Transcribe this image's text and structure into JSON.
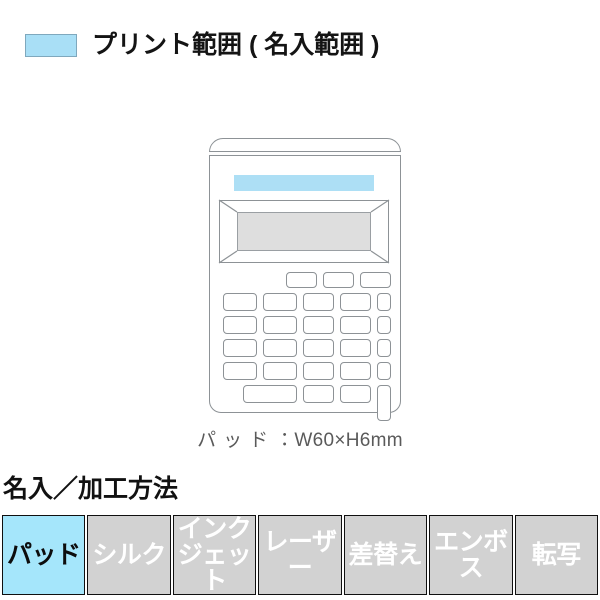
{
  "legend": {
    "swatch_color": "#a9dff6",
    "swatch_border_color": "#7fa8bd",
    "label": "プリント範囲 ( 名入範囲 )"
  },
  "product": {
    "name": "calculator-illustration",
    "imprint_band_color": "#addff5",
    "display_color": "#dedede",
    "outline_color": "#8d9296",
    "dimension_caption": {
      "method": "パッド",
      "separator": "：",
      "size": "W60×H6mm",
      "full": "パッド：W60×H6mm"
    }
  },
  "method_section": {
    "heading": "名入／加工方法",
    "active_color": "#a5e6fb",
    "inactive_color": "#d2d2d2",
    "tabs": [
      {
        "label": "パッド",
        "active": true
      },
      {
        "label": "シルク",
        "active": false
      },
      {
        "label": "インクジェット",
        "active": false
      },
      {
        "label": "レーザー",
        "active": false
      },
      {
        "label": "差替え",
        "active": false
      },
      {
        "label": "エンボス",
        "active": false
      },
      {
        "label": "転写",
        "active": false
      }
    ]
  }
}
